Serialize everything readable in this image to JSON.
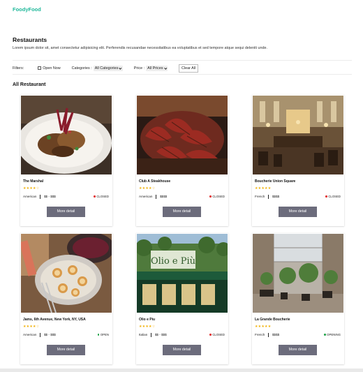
{
  "header": {
    "brand": "FoodyFood"
  },
  "page": {
    "title": "Restaurants",
    "description": "Lorem ipsum dolor sit, amet consectetur adipisicing elit. Perferendis recusandae necessitatibus ea voluptatibus et sed tempore atque sequi deleniti unde."
  },
  "filters": {
    "label": "Filters:",
    "open_now": "Open Now",
    "categories_label": "Categories :",
    "categories_value": "All Categories",
    "price_label": "Price :",
    "price_value": "All Prices",
    "clear_label": "Clear All"
  },
  "section": {
    "title": "All Restaurant"
  },
  "colors": {
    "brand": "#1fb89a",
    "closed": "#e02020",
    "open": "#22a34a",
    "button": "#6c6c7c",
    "star": "#f0b20c"
  },
  "restaurants": [
    {
      "name": "The Marshal",
      "stars": "★★★★☆",
      "category": "American",
      "price": "$$ - $$$",
      "status": "CLOSED",
      "button": "More detail",
      "photo_icon": "plated-meat-photo"
    },
    {
      "name": "Club A Steakhouse",
      "stars": "★★★★☆",
      "category": "American",
      "price": "$$$$",
      "status": "CLOSED",
      "button": "More detail",
      "photo_icon": "sliced-steak-photo"
    },
    {
      "name": "Boucherie Union Square",
      "stars": "★★★★★",
      "category": "French",
      "price": "$$$$",
      "status": "CLOSED",
      "button": "More detail",
      "photo_icon": "restaurant-interior-photo"
    },
    {
      "name": "Jams, 6th Avenue, New York, NY, USA",
      "stars": "★★★★☆",
      "category": "American",
      "price": "$$ - $$$",
      "status": "OPEN",
      "button": "More detail",
      "photo_icon": "scallops-dish-photo"
    },
    {
      "name": "Olio e Piu",
      "stars": "★★★★☆",
      "category": "Italian",
      "price": "$$ - $$$",
      "status": "CLOSED",
      "button": "More detail",
      "photo_icon": "storefront-photo"
    },
    {
      "name": "La Grande Boucherie",
      "stars": "★★★★★",
      "category": "French",
      "price": "$$$$",
      "status": "OPENING",
      "button": "More detail",
      "photo_icon": "atrium-dining-photo"
    }
  ]
}
